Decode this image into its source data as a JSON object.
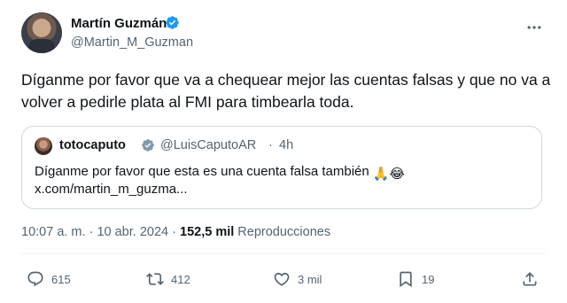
{
  "author": {
    "display_name": "Martín Guzmán",
    "handle": "@Martin_M_Guzman",
    "verified_color": "#1d9bf0"
  },
  "tweet": {
    "text": "Díganme por favor que va a chequear mejor las cuentas falsas y que no va a volver a pedirle plata al FMI para timbearla toda."
  },
  "quote": {
    "display_name": "totocaputo",
    "handle": "@LuisCaputoAR",
    "separator": "·",
    "time": "4h",
    "verified_color": "#829aab",
    "text": "Díganme por favor que esta es una cuenta falsa también",
    "emojis": "🙏😂",
    "link": "x.com/martin_m_guzma..."
  },
  "meta": {
    "time": "10:07 a. m.",
    "sep1": "·",
    "date": "10 abr. 2024",
    "sep2": "·",
    "views_count": "152,5 mil",
    "views_label": "Reproducciones"
  },
  "actions": {
    "replies": "615",
    "reposts": "412",
    "likes": "3 mil",
    "bookmarks": "19"
  },
  "icons": [
    "more-icon",
    "reply-icon",
    "repost-icon",
    "like-icon",
    "bookmark-icon",
    "share-icon",
    "verified-badge-icon"
  ]
}
